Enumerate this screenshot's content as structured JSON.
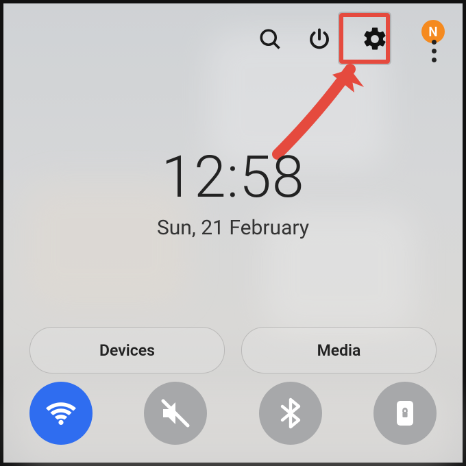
{
  "topbar": {
    "avatar_initial": "N"
  },
  "clock": {
    "time": "12:58",
    "date": "Sun, 21 February"
  },
  "pills": {
    "devices": "Devices",
    "media": "Media"
  },
  "quick": {
    "wifi": {
      "on": true,
      "name": "wifi"
    },
    "mute": {
      "on": false,
      "name": "mute"
    },
    "bluetooth": {
      "on": false,
      "name": "bluetooth"
    },
    "rotation_lock": {
      "on": false,
      "name": "rotation-lock"
    }
  },
  "colors": {
    "highlight": "#e54a3e",
    "avatar": "#f58a1f",
    "toggle_on": "#2f6df0",
    "toggle_off": "#a7a8aa"
  }
}
